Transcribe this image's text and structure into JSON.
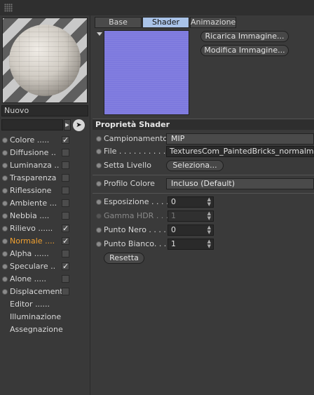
{
  "preview": {
    "material_name": "Nuovo"
  },
  "channels": [
    {
      "label": "Colore",
      "checked": true,
      "has_checkbox": true,
      "active": false
    },
    {
      "label": "Diffusione",
      "checked": false,
      "has_checkbox": true,
      "active": false
    },
    {
      "label": "Luminanza",
      "checked": false,
      "has_checkbox": true,
      "active": false
    },
    {
      "label": "Trasparenza",
      "checked": false,
      "has_checkbox": true,
      "active": false
    },
    {
      "label": "Riflessione",
      "checked": false,
      "has_checkbox": true,
      "active": false
    },
    {
      "label": "Ambiente",
      "checked": false,
      "has_checkbox": true,
      "active": false
    },
    {
      "label": "Nebbia",
      "checked": false,
      "has_checkbox": true,
      "active": false
    },
    {
      "label": "Rilievo",
      "checked": true,
      "has_checkbox": true,
      "active": false
    },
    {
      "label": "Normale",
      "checked": true,
      "has_checkbox": true,
      "active": true
    },
    {
      "label": "Alpha",
      "checked": false,
      "has_checkbox": true,
      "active": false
    },
    {
      "label": "Speculare",
      "checked": true,
      "has_checkbox": true,
      "active": false
    },
    {
      "label": "Alone",
      "checked": false,
      "has_checkbox": true,
      "active": false
    },
    {
      "label": "Displacement",
      "checked": false,
      "has_checkbox": true,
      "active": false
    },
    {
      "label": "Editor",
      "has_checkbox": false,
      "active": false
    },
    {
      "label": "Illuminazione",
      "has_checkbox": false,
      "active": false
    },
    {
      "label": "Assegnazione",
      "has_checkbox": false,
      "active": false
    }
  ],
  "channel_dots": [
    ".....",
    "..",
    "..",
    "",
    "",
    "...",
    "....",
    "......",
    "....",
    "......",
    "..",
    ".....",
    "",
    "......",
    "",
    ""
  ],
  "tabs": [
    "Base",
    "Shader",
    "Animazione"
  ],
  "selected_tab": "Shader",
  "image_buttons": {
    "reload": "Ricarica Immagine...",
    "edit": "Modifica Immagine..."
  },
  "shader_properties": {
    "title": "Proprietà Shader",
    "sampling": {
      "label": "Campionamento",
      "value": "MIP"
    },
    "file": {
      "label": "File . . . . . . . . . . .",
      "value": "TexturesCom_PaintedBricks_normalmap_"
    },
    "set_level": {
      "label": "Setta Livello",
      "button": "Seleziona..."
    },
    "color_profile": {
      "label": "Profilo Colore",
      "value": "Incluso (Default)"
    },
    "exposure": {
      "label": "Esposizione . . . .",
      "value": "0"
    },
    "hdr_gamma": {
      "label": "Gamma HDR . . . .",
      "value": "1"
    },
    "black_point": {
      "label": "Punto Nero . . . .",
      "value": "0"
    },
    "white_point": {
      "label": "Punto Bianco. . .",
      "value": "1"
    },
    "reset": "Resetta"
  },
  "colors": {
    "accent_orange": "#f0a030",
    "tab_selected": "#a9c3e8",
    "normal_map": "#7d79de"
  }
}
